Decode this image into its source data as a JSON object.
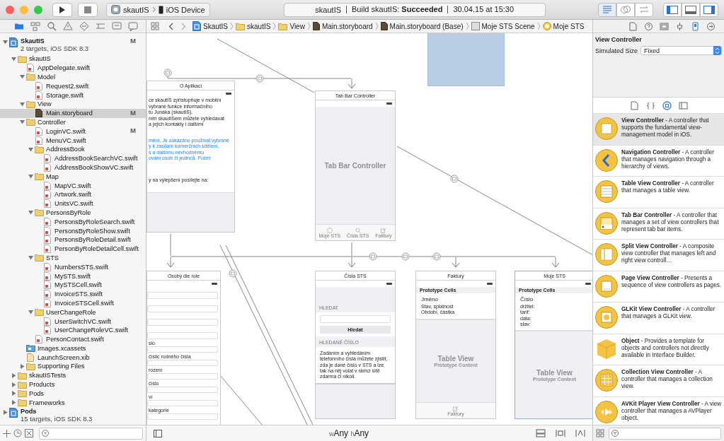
{
  "toolbar": {
    "scheme": "skautIS",
    "device": "iOS Device",
    "status": {
      "project": "skautIS",
      "message": "Build skautIS: **Succeeded**",
      "time": "30.04.15 at 15:30"
    },
    "editor_modes": [
      {
        "selected": true
      },
      {
        "selected": false
      },
      {
        "selected": false
      }
    ],
    "panels": [
      {
        "selected": true
      },
      {
        "selected": false
      },
      {
        "selected": true
      }
    ]
  },
  "navigator": {
    "tabs": [
      {
        "selected": true
      },
      {
        "selected": false
      },
      {
        "selected": false
      },
      {
        "selected": false
      },
      {
        "selected": false
      },
      {
        "selected": false
      },
      {
        "selected": false
      },
      {
        "selected": false
      }
    ],
    "tree": [
      {
        "name": "SkautIS",
        "kind": "project",
        "subtitle": "2 targets, iOS SDK 8.3",
        "badge": "M",
        "expanded": true,
        "selected": false,
        "children": [
          {
            "name": "skautIS",
            "kind": "folder",
            "expanded": true,
            "selected": false,
            "children": [
              {
                "name": "AppDelegate.swift",
                "kind": "swift",
                "selected": false
              },
              {
                "name": "Model",
                "kind": "folder",
                "expanded": true,
                "selected": false,
                "children": [
                  {
                    "name": "Request2.swift",
                    "kind": "swift",
                    "selected": false
                  },
                  {
                    "name": "Storage.swift",
                    "kind": "swift",
                    "selected": false
                  }
                ]
              },
              {
                "name": "View",
                "kind": "folder",
                "expanded": true,
                "selected": false,
                "children": [
                  {
                    "name": "Main.storyboard",
                    "kind": "storyboard",
                    "badge": "M",
                    "selected": true
                  }
                ]
              },
              {
                "name": "Controller",
                "kind": "folder",
                "expanded": true,
                "selected": false,
                "children": [
                  {
                    "name": "LoginVC.swift",
                    "kind": "swift",
                    "badge": "M",
                    "selected": false
                  },
                  {
                    "name": "MenuVC.swift",
                    "kind": "swift",
                    "selected": false
                  },
                  {
                    "name": "AddressBook",
                    "kind": "folder",
                    "expanded": true,
                    "selected": false,
                    "children": [
                      {
                        "name": "AddressBookSearchVC.swift",
                        "kind": "swift",
                        "selected": false
                      },
                      {
                        "name": "AddressBookShowVC.swift",
                        "kind": "swift",
                        "selected": false
                      }
                    ]
                  },
                  {
                    "name": "Map",
                    "kind": "folder",
                    "expanded": true,
                    "selected": false,
                    "children": [
                      {
                        "name": "MapVC.swift",
                        "kind": "swift",
                        "selected": false
                      },
                      {
                        "name": "Artwork.swift",
                        "kind": "swift",
                        "selected": false
                      },
                      {
                        "name": "UnitsVC.swift",
                        "kind": "swift",
                        "selected": false
                      }
                    ]
                  },
                  {
                    "name": "PersonsByRole",
                    "kind": "folder",
                    "expanded": true,
                    "selected": false,
                    "children": [
                      {
                        "name": "PersonsByRoleSearch.swift",
                        "kind": "swift",
                        "selected": false
                      },
                      {
                        "name": "PersonsByRoleShow.swift",
                        "kind": "swift",
                        "selected": false
                      },
                      {
                        "name": "PersonsByRoleDetail.swift",
                        "kind": "swift",
                        "selected": false
                      },
                      {
                        "name": "PersonByRoleDetailCell.swift",
                        "kind": "swift",
                        "selected": false
                      }
                    ]
                  },
                  {
                    "name": "STS",
                    "kind": "folder",
                    "expanded": true,
                    "selected": false,
                    "children": [
                      {
                        "name": "NumbersSTS.swift",
                        "kind": "swift",
                        "selected": false
                      },
                      {
                        "name": "MySTS.swift",
                        "kind": "swift",
                        "selected": false
                      },
                      {
                        "name": "MySTSCell.swift",
                        "kind": "swift",
                        "selected": false
                      },
                      {
                        "name": "InvoiceSTS.swift",
                        "kind": "swift",
                        "selected": false
                      },
                      {
                        "name": "InvoiceSTSCell.swift",
                        "kind": "swift",
                        "selected": false
                      }
                    ]
                  },
                  {
                    "name": "UserChangeRole",
                    "kind": "folder",
                    "expanded": true,
                    "selected": false,
                    "children": [
                      {
                        "name": "UserSwitchVC.swift",
                        "kind": "swift",
                        "selected": false
                      },
                      {
                        "name": "UserChangeRoleVC.swift",
                        "kind": "swift",
                        "selected": false
                      }
                    ]
                  },
                  {
                    "name": "PersonContact.swift",
                    "kind": "swift",
                    "selected": false
                  }
                ]
              },
              {
                "name": "Images.xcassets",
                "kind": "assets",
                "selected": false
              },
              {
                "name": "LaunchScreen.xib",
                "kind": "xib",
                "selected": false
              },
              {
                "name": "Supporting Files",
                "kind": "folder",
                "expanded": false,
                "selected": false
              }
            ]
          },
          {
            "name": "skautISTests",
            "kind": "folder",
            "expanded": false,
            "selected": false
          },
          {
            "name": "Products",
            "kind": "folder",
            "expanded": false,
            "selected": false
          },
          {
            "name": "Pods",
            "kind": "folder",
            "expanded": false,
            "selected": false
          },
          {
            "name": "Frameworks",
            "kind": "folder",
            "expanded": false,
            "selected": false
          }
        ]
      },
      {
        "name": "Pods",
        "kind": "project",
        "subtitle": "15 targets, iOS SDK 8.3",
        "expanded": false,
        "selected": false
      }
    ]
  },
  "jump_bar": [
    {
      "label": "SkautIS",
      "kind": "project"
    },
    {
      "label": "skautIS",
      "kind": "folder"
    },
    {
      "label": "View",
      "kind": "folder"
    },
    {
      "label": "Main.storyboard",
      "kind": "storyboard"
    },
    {
      "label": "Main.storyboard (Base)",
      "kind": "storyboard"
    },
    {
      "label": "Moje STS Scene",
      "kind": "scene"
    },
    {
      "label": "Moje STS",
      "kind": "controller"
    }
  ],
  "canvas": {
    "scenes": [
      {
        "title": "O Aplikaci",
        "kind": "text",
        "selected": false,
        "paragraphs": [
          {
            "kind": "plain",
            "lines": [
              "ce skautIS zpřístupňuje v mobilní",
              "vybrané funkce informačního",
              "tu Junáka (skautIS).",
              "ním skautISem můžete vyhledávat",
              "a jejich kontakty i dalšími"
            ]
          },
          {
            "kind": "link",
            "lines": [
              "mění. Je zakázáno používat vybrané",
              "y k zasílání komerčních sdělení,",
              "s a dalšímu nevhodnému",
              "ování osob či jedinců. Počet"
            ]
          },
          {
            "kind": "plain",
            "lines": [
              "y na vylepšení posílejte na:"
            ]
          }
        ]
      },
      {
        "title": "Tab Bar Controller",
        "kind": "tabs",
        "selected": false,
        "placeholder": "Tab Bar Controller",
        "tabs": [
          {
            "label": "Moje STS"
          },
          {
            "label": "Čísla STS"
          },
          {
            "label": "Faktury"
          }
        ]
      },
      {
        "title": "Osoby dle role",
        "kind": "form",
        "selected": false,
        "fields": [
          {
            "kind": "plain"
          },
          {
            "kind": "plain"
          },
          {
            "kind": "plain"
          },
          {
            "kind": "plain"
          },
          {
            "kind": "labeled",
            "label": "slo"
          },
          {
            "kind": "labeled",
            "label": "číslic rodného čísla"
          },
          {
            "kind": "labeled",
            "label": "rození"
          },
          {
            "kind": "labeled",
            "label": "číslo"
          },
          {
            "kind": "labeled",
            "label": "ví"
          },
          {
            "kind": "labeled",
            "label": "kategorie"
          }
        ]
      },
      {
        "title": "Čísla STS",
        "kind": "search",
        "selected": false,
        "search_header": "HLEDAT",
        "button": "Hledat",
        "result_header": "HLEDANÉ ČÍSLO",
        "note": "Zadáním a vyhledáním telefonního čísla můžete zjistit, zda je dané číslo v STS a lze tak na něj volat v rámci sítě zdarma či nikoli."
      },
      {
        "title": "Faktury",
        "kind": "table",
        "selected": false,
        "header": "Prototype Cells",
        "cell_title": "Jméno",
        "cell_lines": [
          "Stav, splatnost",
          "Období, částka"
        ],
        "placeholder": "Table View",
        "placeholder_subtitle": "Prototype Content",
        "tab": "Faktury"
      },
      {
        "title": "Moje STS",
        "kind": "table",
        "selected": true,
        "header": "Prototype Cells",
        "cell_title": "Číslo",
        "cell_lines": [
          "držitel:",
          "tarif:",
          "data:",
          "stav:"
        ],
        "placeholder": "Table View",
        "placeholder_subtitle": "Prototype Content"
      }
    ],
    "size_class": {
      "width_prefix": "w",
      "width": "Any",
      "height_prefix": "h",
      "height": "Any"
    }
  },
  "inspector": {
    "tabs": [
      {
        "selected": false
      },
      {
        "selected": false
      },
      {
        "selected": false
      },
      {
        "selected": false
      },
      {
        "selected": true
      },
      {
        "selected": false
      }
    ],
    "title": "View Controller",
    "simulated_size": {
      "label": "Simulated Size",
      "value": "Fixed"
    },
    "library_tabs": [
      {
        "selected": false
      },
      {
        "selected": false
      },
      {
        "selected": true
      },
      {
        "selected": false
      }
    ],
    "library": [
      {
        "kind": "view",
        "selected": true,
        "text": "**View Controller** - A controller that supports the fundamental view-management model in iOS."
      },
      {
        "kind": "navigation",
        "selected": false,
        "text": "**Navigation Controller** - A controller that manages navigation through a hierarchy of views."
      },
      {
        "kind": "table",
        "selected": false,
        "text": "**Table View Controller** - A controller that manages a table view."
      },
      {
        "kind": "tab_bar",
        "selected": false,
        "text": "**Tab Bar Controller** - A controller that manages a set of view controllers that represent tab bar items."
      },
      {
        "kind": "split",
        "selected": false,
        "text": "**Split View Controller** - A composite view controller that manages left and right view controll…"
      },
      {
        "kind": "page",
        "selected": false,
        "text": "**Page View Controller** - Presents a sequence of view controllers as pages."
      },
      {
        "kind": "glkit",
        "selected": false,
        "text": "**GLKit View Controller** - A controller that manages a GLKit view."
      },
      {
        "kind": "object",
        "selected": false,
        "text": "**Object** - Provides a template for objects and controllers not directly available in Interface Builder."
      },
      {
        "kind": "collection",
        "selected": false,
        "text": "**Collection View Controller** - A controller that manages a collection view."
      },
      {
        "kind": "avkit",
        "selected": false,
        "text": "**AVKit Player View Controller** - A view controller that manages a AVPlayer object."
      }
    ]
  }
}
